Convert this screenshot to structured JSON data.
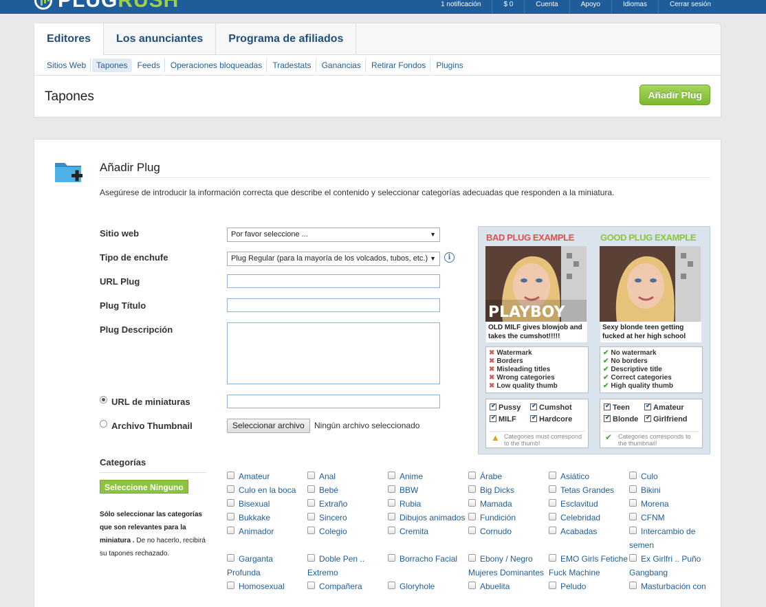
{
  "topbar": {
    "logo_a": "PLUG",
    "logo_b": "RUSH",
    "links": [
      "1 notificación",
      "$ 0",
      "Cuenta",
      "Apoyo",
      "Idiomas",
      "Cerrar sesión"
    ]
  },
  "tabs": [
    "Editores",
    "Los anunciantes",
    "Programa de afiliados"
  ],
  "subnav": [
    "Sitios Web",
    "Tapones",
    "Feeds",
    "Operaciones bloqueadas",
    "Tradestats",
    "Ganancias",
    "Retirar Fondos",
    "Plugins"
  ],
  "page": {
    "title": "Tapones",
    "add_button": "Añadir Plug"
  },
  "form": {
    "title": "Añadir Plug",
    "description": "Asegúrese de introducir la información correcta que describe el contenido y seleccionar categorías adecuadas que responden a la miniatura.",
    "site_label": "Sitio web",
    "site_value": "Por favor seleccione ...",
    "type_label": "Tipo de enchufe",
    "type_value": "Plug Regular (para la mayoría de los volcados, tubos, etc.)",
    "url_label": "URL Plug",
    "title_label": "Plug Título",
    "desc_label": "Plug Descripción",
    "thumb_url_label": "URL de miniaturas",
    "thumb_file_label": "Archivo Thumbnail",
    "file_button": "Seleccionar archivo",
    "file_status": "Ningún archivo seleccionado"
  },
  "examples": {
    "bad": {
      "heading": "BAD PLUG EXAMPLE",
      "caption": "OLD MILF gives blowjob and takes the cumshot!!!!!",
      "watermark": "PLAYBOY",
      "issues": [
        "Watermark",
        "Borders",
        "Misleading titles",
        "Wrong categories",
        "Low quality thumb"
      ],
      "tags": [
        "Pussy",
        "Cumshot",
        "MILF",
        "Hardcore"
      ],
      "note": "Categories must correspond to the thumb!"
    },
    "good": {
      "heading": "GOOD PLUG EXAMPLE",
      "caption": "Sexy blonde teen getting fucked at her high school",
      "issues": [
        "No watermark",
        "No borders",
        "Descriptive title",
        "Correct categories",
        "High quality thumb"
      ],
      "tags": [
        "Teen",
        "Amateur",
        "Blonde",
        "Girlfriend"
      ],
      "note": "Categories corresponds to the thumbnail!"
    },
    "colors": {
      "bad": "#d9534f",
      "good": "#8cc43f"
    }
  },
  "categories": {
    "title": "Categorías",
    "select_none": "Seleccione Ninguno",
    "help_bold": "Sólo seleccionar las categorías que son relevantes para la miniatura .",
    "help_rest": "De no hacerlo, recibirá su tapones rechazado.",
    "items": [
      "Amateur",
      "Anal",
      "Anime",
      "Árabe",
      "Asiático",
      "Culo",
      "Culo en la boca",
      "Bebé",
      "BBW",
      "Big Dicks",
      "Tetas Grandes",
      "Bikini",
      "Bisexual",
      "Extraño",
      "Rubia",
      "Mamada",
      "Esclavitud",
      "Morena",
      "Bukkake",
      "Sincero",
      "Dibujos animados",
      "Fundición",
      "Celebridad",
      "CFNM",
      "Animador",
      "Colegio",
      "Cremita",
      "Cornudo",
      "Acabadas",
      "Intercambio de semen",
      "Garganta Profunda",
      "Doble Pen .. Extremo",
      "Borracho Facial",
      "Ebony / Negro Mujeres Dominantes",
      "EMO Girls Fetiche Fuck Machine",
      "Ex Girlfri .. Puño Gangbang",
      "Homosexual",
      "Compañera",
      "Gloryhole",
      "Abuelita",
      "Peludo",
      "Masturbación con"
    ]
  }
}
